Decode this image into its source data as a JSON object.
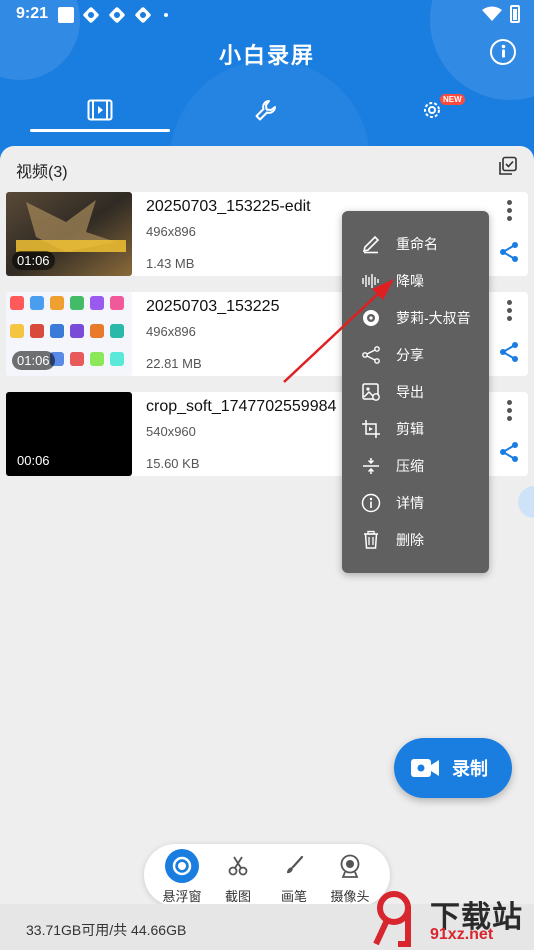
{
  "status_bar": {
    "time": "9:21"
  },
  "app": {
    "title": "小白录屏"
  },
  "tabs": [
    {
      "name": "videos",
      "icon": "video-icon"
    },
    {
      "name": "tools",
      "icon": "wrench-icon"
    },
    {
      "name": "settings",
      "icon": "gear-icon",
      "badge": "NEW"
    }
  ],
  "section": {
    "title": "视频(3)"
  },
  "videos": [
    {
      "name": "20250703_153225-edit",
      "resolution": "496x896",
      "size": "1.43 MB",
      "duration": "01:06"
    },
    {
      "name": "20250703_153225",
      "resolution": "496x896",
      "size": "22.81 MB",
      "duration": "01:06"
    },
    {
      "name": "crop_soft_1747702559984",
      "resolution": "540x960",
      "size": "15.60 KB",
      "duration": "00:06"
    }
  ],
  "context_menu": {
    "items": [
      {
        "label": "重命名",
        "icon": "pencil-icon"
      },
      {
        "label": "降噪",
        "icon": "waveform-icon"
      },
      {
        "label": "萝莉-大叔音",
        "icon": "voice-change-icon"
      },
      {
        "label": "分享",
        "icon": "share-icon"
      },
      {
        "label": "导出",
        "icon": "export-image-icon"
      },
      {
        "label": "剪辑",
        "icon": "crop-icon"
      },
      {
        "label": "压缩",
        "icon": "compress-icon"
      },
      {
        "label": "详情",
        "icon": "info-icon"
      },
      {
        "label": "删除",
        "icon": "trash-icon"
      }
    ]
  },
  "record_button": {
    "label": "录制"
  },
  "toolbar": {
    "items": [
      {
        "label": "悬浮窗",
        "icon": "floating-window-icon"
      },
      {
        "label": "截图",
        "icon": "scissors-icon"
      },
      {
        "label": "画笔",
        "icon": "brush-icon"
      },
      {
        "label": "摄像头",
        "icon": "camera-icon"
      }
    ]
  },
  "footer": {
    "storage": "33.71GB可用/共 44.66GB"
  },
  "watermark": {
    "text": "下载站",
    "url": "91xz.net"
  },
  "colors": {
    "primary": "#1a7de0",
    "menu_bg": "#606060",
    "arrow": "#e02020",
    "badge": "#ff4a3d"
  }
}
